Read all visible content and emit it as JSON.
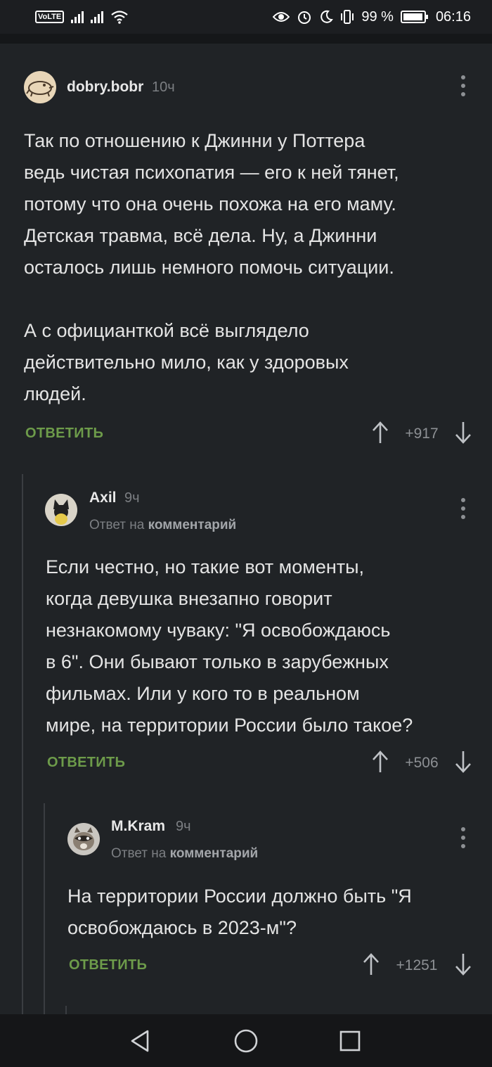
{
  "status_bar": {
    "volte": "VoLTE",
    "battery_percent": "99 %",
    "time": "06:16",
    "icons": [
      "volte-icon",
      "signal-icon",
      "signal-icon",
      "wifi-icon",
      "eye-icon",
      "alarm-icon",
      "moon-icon",
      "vibrate-icon",
      "battery-icon"
    ]
  },
  "comments": [
    {
      "author": "dobry.bobr",
      "time": "10ч",
      "reply_to": null,
      "text": "Так по отношению к Джинни у Поттера\nведь чистая психопатия — его к ней тянет,\nпотому что она очень похожа на его маму.\nДетская травма, всё дела. Ну, а Джинни\nосталось лишь немного помочь ситуации.\n\nА с официанткой всё выглядело\nдействительно мило, как у здоровых\nлюдей.",
      "reply_label": "ОТВЕТИТЬ",
      "score": "+917"
    },
    {
      "author": "Axil",
      "time": "9ч",
      "reply_to_prefix": "Ответ на",
      "reply_to_target": "комментарий",
      "text": "Если честно, но такие вот моменты,\nкогда девушка внезапно говорит\nнезнакомому чуваку: \"Я освобождаюсь\nв 6\". Они бывают только в зарубежных\nфильмах. Или у кого то в реальном\nмире, на территории России было такое?",
      "reply_label": "ОТВЕТИТЬ",
      "score": "+506"
    },
    {
      "author": "M.Kram",
      "time": "9ч",
      "reply_to_prefix": "Ответ на",
      "reply_to_target": "комментарий",
      "text": "На территории России должно быть \"Я\nосвобождаюсь в 2023-м\"?",
      "reply_label": "ОТВЕТИТЬ",
      "score": "+1251"
    }
  ],
  "nav_bar": {
    "icons": [
      "back-icon",
      "home-icon",
      "recents-icon"
    ]
  },
  "colors": {
    "background": "#202326",
    "accent_green": "#6d9b4a",
    "muted_text": "#7c7f83"
  }
}
